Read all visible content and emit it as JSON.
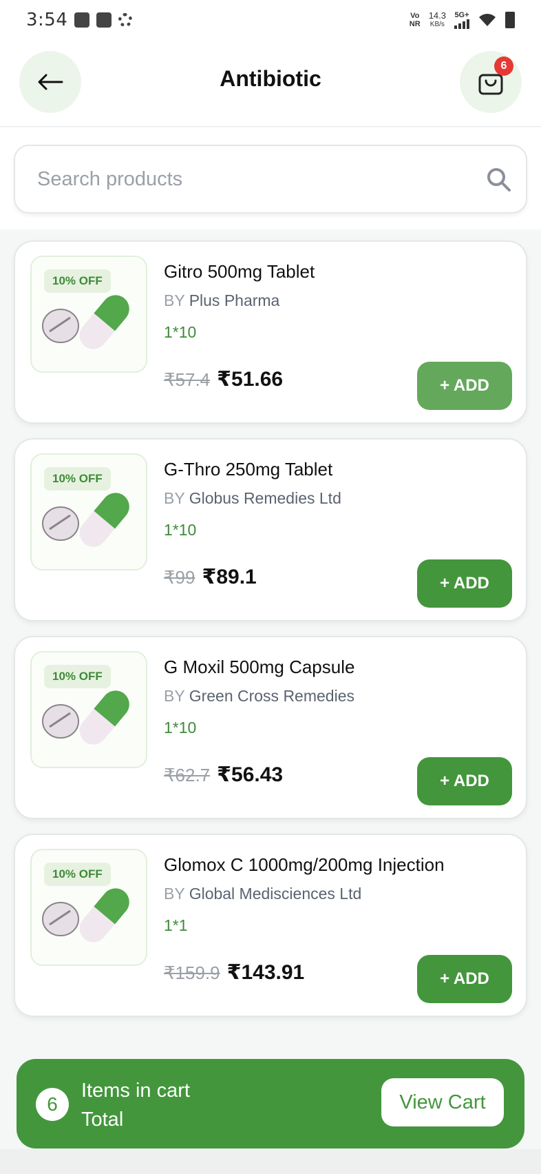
{
  "status_bar": {
    "time": "3:54",
    "volte": "Vo\nNR",
    "speed": "14.3",
    "speed_unit": "KB/s",
    "network": "5G+"
  },
  "header": {
    "title": "Antibiotic",
    "cart_count": "6",
    "back_icon": "arrow-left-icon",
    "cart_icon": "shopping-bag-icon"
  },
  "search": {
    "placeholder": "Search products",
    "value": ""
  },
  "products": [
    {
      "discount": "10% OFF",
      "name": "Gitro 500mg Tablet",
      "by": "BY",
      "brand": "Plus Pharma",
      "pack": "1*10",
      "mrp": "₹57.4",
      "price": "₹51.66",
      "add_label": "+ ADD"
    },
    {
      "discount": "10% OFF",
      "name": "G-Thro 250mg Tablet",
      "by": "BY",
      "brand": "Globus Remedies Ltd",
      "pack": "1*10",
      "mrp": "₹99",
      "price": "₹89.1",
      "add_label": "+ ADD"
    },
    {
      "discount": "10% OFF",
      "name": "G Moxil 500mg Capsule",
      "by": "BY",
      "brand": "Green Cross Remedies",
      "pack": "1*10",
      "mrp": "₹62.7",
      "price": "₹56.43",
      "add_label": "+ ADD"
    },
    {
      "discount": "10% OFF",
      "name": "Glomox C 1000mg/200mg Injection",
      "by": "BY",
      "brand": "Global Medisciences Ltd",
      "pack": "1*1",
      "mrp": "₹159.9",
      "price": "₹143.91",
      "add_label": "+ ADD"
    }
  ],
  "cart_bar": {
    "count": "6",
    "items_label": "Items in cart",
    "total_label": "Total",
    "view_cart_label": "View Cart"
  },
  "colors": {
    "primary_green": "#43963c",
    "light_green": "#ecf5e9",
    "badge_red": "#e53935"
  }
}
